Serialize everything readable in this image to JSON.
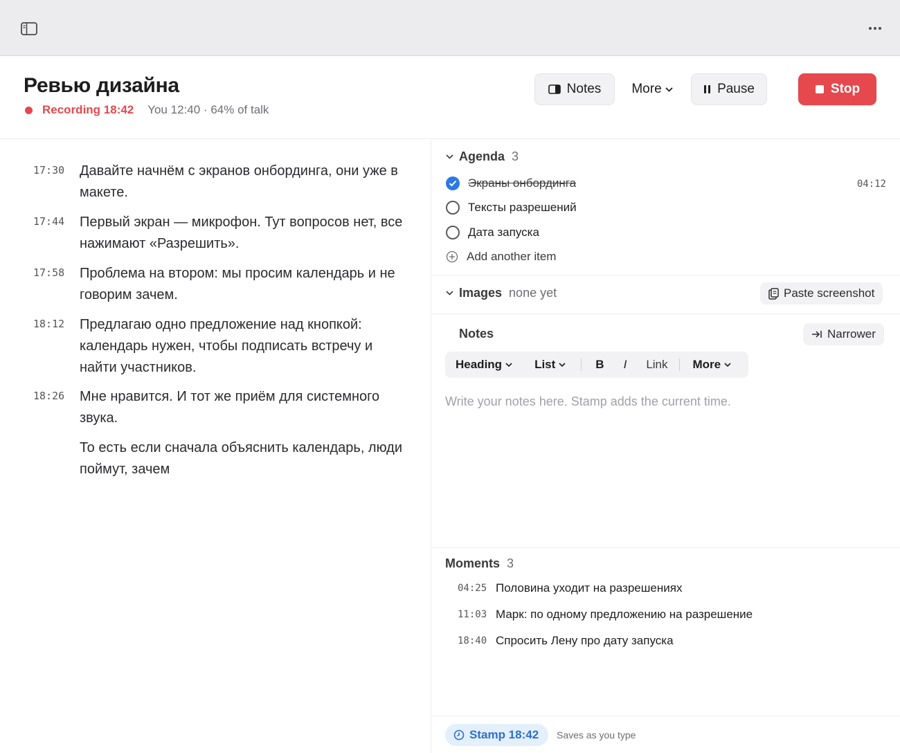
{
  "window": {
    "more_label": "..."
  },
  "header": {
    "title": "Ревью дизайна",
    "recording": "Recording 18:42",
    "talk_stats": "You 12:40 · 64% of talk",
    "buttons": {
      "notes": "Notes",
      "more": "More",
      "pause": "Pause",
      "stop": "Stop"
    }
  },
  "transcript": [
    {
      "time": "17:30",
      "text": "Давайте начнём с экранов онбординга, они уже в макете."
    },
    {
      "time": "17:44",
      "text": "Первый экран — микрофон. Тут вопросов нет, все нажимают «Разрешить»."
    },
    {
      "time": "17:58",
      "text": "Проблема на втором: мы просим календарь и не говорим зачем."
    },
    {
      "time": "18:12",
      "text": "Предлагаю одно предложение над кнопкой: календарь нужен, чтобы подписать встречу и найти участников."
    },
    {
      "time": "18:26",
      "text": "Мне нравится. И тот же приём для системного звука."
    },
    {
      "time": "",
      "text": "То есть если сначала объяснить календарь, люди поймут, зачем"
    }
  ],
  "agenda": {
    "title": "Agenda",
    "count": "3",
    "items": [
      {
        "label": "Экраны онбординга",
        "done": true,
        "time": "04:12"
      },
      {
        "label": "Тексты разрешений",
        "done": false
      },
      {
        "label": "Дата запуска",
        "done": false
      }
    ],
    "add_label": "Add another item"
  },
  "images": {
    "title": "Images",
    "status": "none yet",
    "paste_label": "Paste screenshot"
  },
  "notes": {
    "title": "Notes",
    "narrower_label": "Narrower",
    "toolbar": {
      "heading": "Heading",
      "list": "List",
      "bold": "B",
      "italic": "I",
      "link": "Link",
      "more": "More"
    },
    "placeholder": "Write your notes here. Stamp adds the current time."
  },
  "moments": {
    "title": "Moments",
    "count": "3",
    "items": [
      {
        "time": "04:25",
        "text": "Половина уходит на разрешениях"
      },
      {
        "time": "11:03",
        "text": "Марк: по одному предложению на разрешение"
      },
      {
        "time": "18:40",
        "text": "Спросить Лену про дату запуска"
      }
    ]
  },
  "footer": {
    "stamp_label": "Stamp 18:42",
    "saves_text": "Saves as you type"
  },
  "colors": {
    "accent_red": "#e5484d",
    "accent_blue": "#2c78e4",
    "stamp_bg": "#e4effc"
  }
}
